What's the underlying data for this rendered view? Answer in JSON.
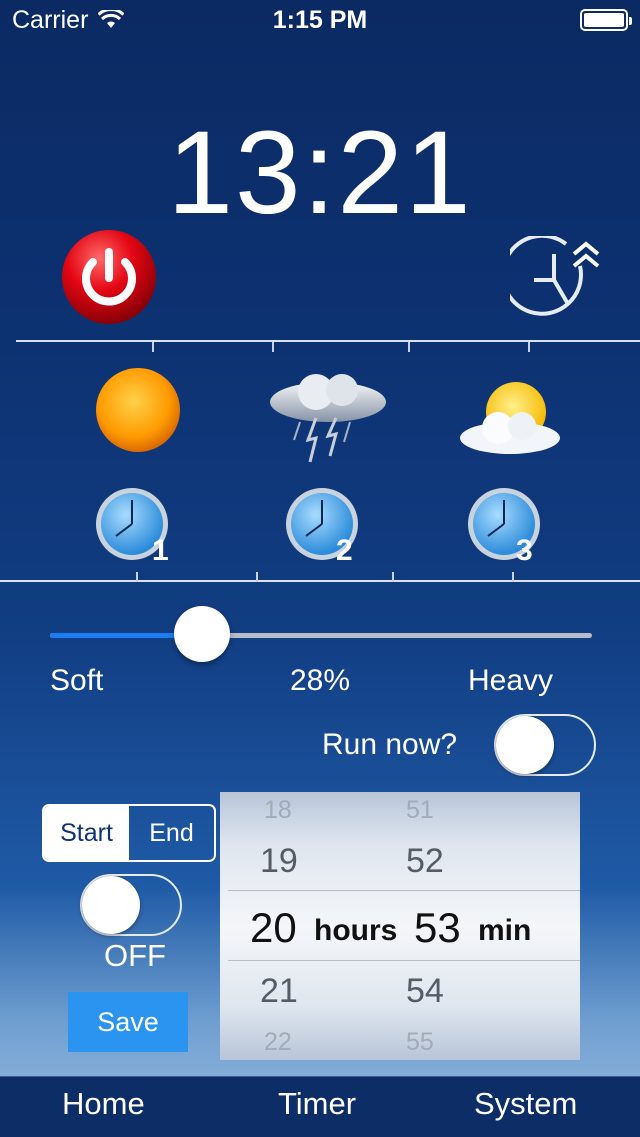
{
  "status_bar": {
    "carrier": "Carrier",
    "time": "1:15 PM"
  },
  "clock": {
    "time": "13:21"
  },
  "weather": {
    "items": [
      {
        "icon": "sun-icon",
        "alarm_icon": "alarm-clock-icon",
        "alarm_number": "1"
      },
      {
        "icon": "storm-cloud-icon",
        "alarm_icon": "alarm-clock-icon",
        "alarm_number": "2"
      },
      {
        "icon": "partly-cloudy-icon",
        "alarm_icon": "alarm-clock-icon",
        "alarm_number": "3"
      }
    ]
  },
  "intensity": {
    "min_label": "Soft",
    "value_label": "28%",
    "max_label": "Heavy",
    "value": 0.28
  },
  "run_now": {
    "label": "Run now?",
    "on": false
  },
  "schedule": {
    "segments": [
      "Start",
      "End"
    ],
    "selected": "Start",
    "toggle_state": "OFF",
    "save_label": "Save"
  },
  "picker": {
    "hours": [
      "18",
      "19",
      "20",
      "21",
      "22"
    ],
    "minutes": [
      "51",
      "52",
      "53",
      "54",
      "55"
    ],
    "hours_unit": "hours",
    "minutes_unit": "min"
  },
  "tabbar": {
    "tabs": [
      "Home",
      "Timer",
      "System"
    ]
  },
  "colors": {
    "accent": "#1a7ef2",
    "power_red": "#e30613",
    "save_blue": "#2a94f0"
  }
}
